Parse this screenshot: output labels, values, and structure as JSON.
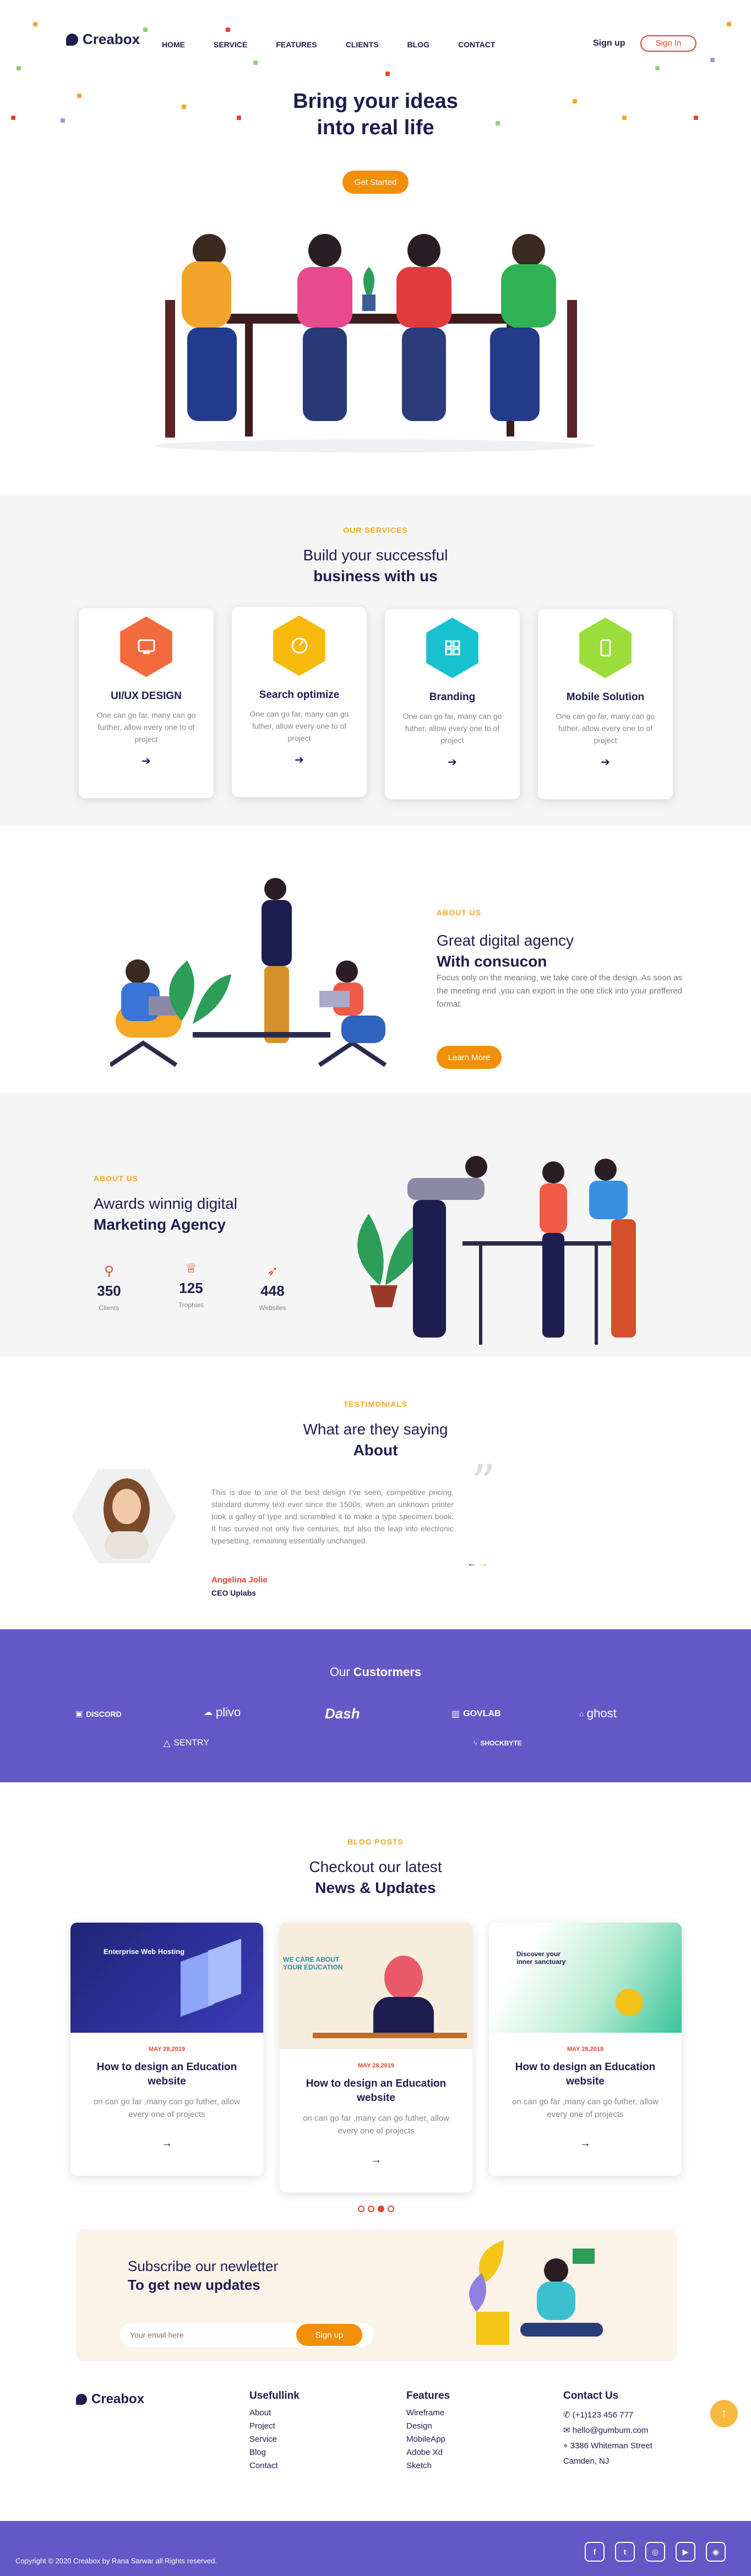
{
  "header": {
    "logo": "Creabox",
    "nav": [
      "HOME",
      "SERVICE",
      "FEATURES",
      "CLIENTS",
      "BLOG",
      "CONTACT"
    ],
    "signup": "Sign up",
    "signin": "Sign In"
  },
  "hero": {
    "title_line1": "Bring your ideas",
    "title_line2": "into real life",
    "cta": "Get Started"
  },
  "services": {
    "tag": "OUR SERVICES",
    "title_line1": "Build your successful",
    "title_line2": "business with us",
    "items": [
      {
        "title": "UI/UX DESIGN",
        "desc": "One can go far, many can go further, allow every one to of project",
        "color": "#f26a3d",
        "icon": "screen-icon"
      },
      {
        "title": "Search optimize",
        "desc": "One can go far, many can go futher, allow every one to of project",
        "color": "#f6b90c",
        "icon": "gauge-icon"
      },
      {
        "title": "Branding",
        "desc": "One can go far, many can go futher, allow every one to of project",
        "color": "#17c1d0",
        "icon": "grid-icon"
      },
      {
        "title": "Mobile Solution",
        "desc": "One can go far, many can go futher, allow every one to of project",
        "color": "#9bdd3a",
        "icon": "phone-icon"
      }
    ]
  },
  "about1": {
    "tag": "ABOUT US",
    "title_line1": "Great digital agency",
    "title_line2": "With consucon",
    "desc": "Focus only on the meaning, we take care of the design. As soon as the meeting end ,you can export in the one click into your preffered format.",
    "cta": "Learn More"
  },
  "about2": {
    "tag": "ABOUT US",
    "title_line1": "Awards winnig digital",
    "title_line2": "Marketing Agency",
    "stats": [
      {
        "value": "350",
        "label": "Clients"
      },
      {
        "value": "125",
        "label": "Trophies"
      },
      {
        "value": "448",
        "label": "Websites"
      }
    ]
  },
  "testimonials": {
    "tag": "TESTIMONIALS",
    "title_line1": "What are they saying",
    "title_line2": "About",
    "quote": "This is due to one of the best design I've seen, competitive pricing, standard dummy text ever since the 1500s, when an unknown printer took a galley of type and scrambled it to make a type specimen book. It has survied not only five centuries, but also the leap into electronic typesetting, remaining essentially unchanged.",
    "name": "Angelina Jolie",
    "role": "CEO Uplabs"
  },
  "customers": {
    "title_light": "Our",
    "title_bold": "Custormers",
    "logos": [
      "DISCORD",
      "plivo",
      "Dash",
      "GOVLAB",
      "ghost",
      "SENTRY",
      "SHOCKBYTE"
    ]
  },
  "blog": {
    "tag": "BLOG POSTS",
    "title_line1": "Checkout our latest",
    "title_line2": "News & Updates",
    "posts": [
      {
        "date": "MAY 28,2019",
        "title": "How to design an Education website",
        "desc": "on can go far ,many can go futher, allow every one of projects",
        "thumb_heading": "Enterprise Web Hosting"
      },
      {
        "date": "MAY 28,2019",
        "title": "How to design an Education website",
        "desc": "on can go far ,many can go futher, allow every one of projects",
        "thumb_heading": "WE CARE ABOUT YOUR EDUCATION"
      },
      {
        "date": "MAY 28,2019",
        "title": "How to design an Education website",
        "desc": "on can go far ,many can go futher, allow every one of projects",
        "thumb_heading": "Discover your inner sanctuary"
      }
    ]
  },
  "newsletter": {
    "title_line1": "Subscribe our newletter",
    "title_line2": "To get new updates",
    "placeholder": "Your email here",
    "button": "Sign up"
  },
  "footer": {
    "logo": "Creabox",
    "col1": {
      "title": "Usefullink",
      "links": [
        "About",
        "Project",
        "Service",
        "Blog",
        "Contact"
      ]
    },
    "col2": {
      "title": "Features",
      "links": [
        "Wireframe",
        "Design",
        "MobileApp",
        "Adobe Xd",
        "Sketch"
      ]
    },
    "contact": {
      "title": "Contact Us",
      "phone": "(+1)123 456 777",
      "email": "hello@gumbum.com",
      "address_line1": "3386 Whiteman Street",
      "address_line2": "Camden, NJ"
    }
  },
  "copyright": "Copyright © 2020 Creabox by Rana Sarwar all Rights reserved.",
  "colors": {
    "accent": "#f0900a",
    "purple": "#6457c6",
    "navy": "#1d1d4f",
    "red": "#e2452c"
  }
}
